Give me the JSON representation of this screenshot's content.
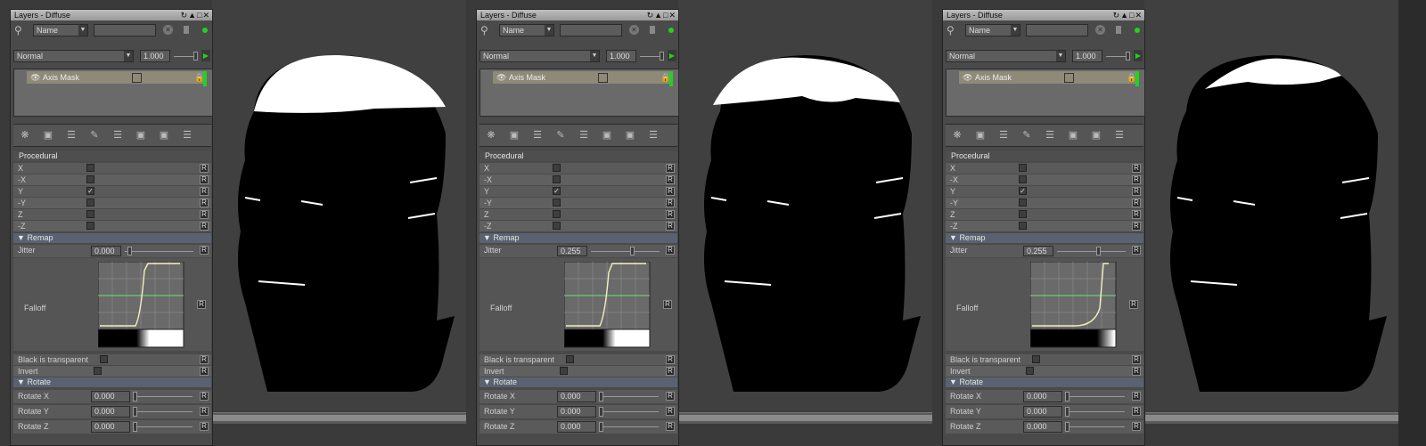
{
  "panel": {
    "title": "Layers - Diffuse",
    "search_field": "Name",
    "blend_mode": "Normal",
    "opacity": "1.000",
    "layer_name": "Axis Mask",
    "procedural_label": "Procedural",
    "axes": [
      "X",
      "-X",
      "Y",
      "-Y",
      "Z",
      "-Z"
    ],
    "remap_label": "Remap",
    "jitter_label": "Jitter",
    "falloff_label": "Falloff",
    "black_transparent_label": "Black is transparent",
    "invert_label": "Invert",
    "rotate_label": "Rotate",
    "rotate_x_label": "Rotate X",
    "rotate_y_label": "Rotate Y",
    "rotate_z_label": "Rotate Z",
    "rotate_value": "0.000",
    "reset_label": "R",
    "check_mark": "✓"
  },
  "panes": [
    {
      "jitter": "0.000",
      "jitter_level": 0.0,
      "checked_axis": "Y"
    },
    {
      "jitter": "0.255",
      "jitter_level": 0.255,
      "checked_axis": "Y"
    },
    {
      "jitter": "0.255",
      "jitter_level": 0.255,
      "checked_axis": "Y"
    }
  ],
  "icons": [
    "search-icon",
    "clear-icon",
    "play-icon",
    "eye-icon",
    "lock-icon",
    "add-layer-icon"
  ]
}
